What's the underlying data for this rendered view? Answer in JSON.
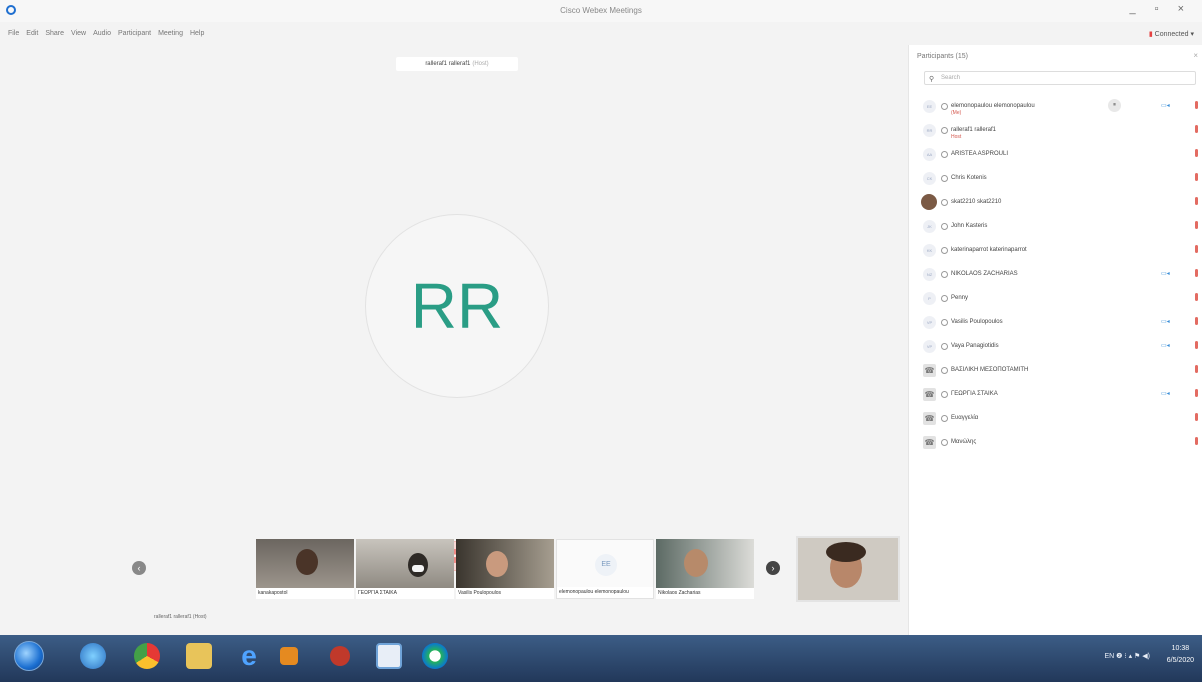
{
  "window": {
    "title": "Cisco Webex Meetings",
    "controls": "_ ▫ ×",
    "connection_status": "Connected ▾",
    "status_color": "#e54141"
  },
  "menu": [
    "File",
    "Edit",
    "Share",
    "View",
    "Audio",
    "Participant",
    "Meeting",
    "Help"
  ],
  "stage": {
    "active_speaker": "ralleraf1 ralleraf1",
    "active_speaker_role": "(Host)",
    "avatar_initials": "RR",
    "avatar_color": "#2a9d85",
    "mute_icon": "microphone-muted-icon"
  },
  "filmstrip": {
    "tiles": [
      {
        "label": "kanakapostol",
        "kind": "video"
      },
      {
        "label": "ΓΕΩΡΓΙΑ ΣΤΑΙΚΑ",
        "kind": "video"
      },
      {
        "label": "Vasilis Poulopoulos",
        "kind": "video"
      },
      {
        "label": "elemonopaulou elemonopaulou",
        "kind": "empty",
        "initials": "EE"
      },
      {
        "label": "Nikolaos Zacharias",
        "kind": "video"
      }
    ],
    "under_label": "ralleraf1 ralleraf1 (Host)"
  },
  "panel": {
    "title": "Participants (15)",
    "search_placeholder": "Search",
    "participants": [
      {
        "name": "elemonopaulou elemonopaulou",
        "sub": "(Me)",
        "initials": "EE",
        "cam": true,
        "badge": "⏸"
      },
      {
        "name": "ralleraf1 ralleraf1",
        "sub": "Host",
        "initials": "RR",
        "cam": false
      },
      {
        "name": "ARISTEA ASPROULI",
        "initials": "AA",
        "cam": false
      },
      {
        "name": "Chris Kotenis",
        "initials": "CK",
        "cam": false
      },
      {
        "name": "skat2210 skat2210",
        "initials": "",
        "photo": true,
        "cam": false
      },
      {
        "name": "John Kasteris",
        "initials": "JK",
        "cam": false
      },
      {
        "name": "katerinaparrot katerinaparrot",
        "initials": "KK",
        "cam": false
      },
      {
        "name": "NIKOLAOS ZACHARIAS",
        "initials": "NZ",
        "cam": true
      },
      {
        "name": "Penny",
        "initials": "P",
        "cam": false
      },
      {
        "name": "Vasilis Poulopoulos",
        "initials": "VP",
        "cam": true
      },
      {
        "name": "Vaya Panagiotidis",
        "initials": "VP",
        "cam": true
      },
      {
        "name": "ΒΑΣΙΛΙΚΗ ΜΕΣΟΠΟΤΑΜΙΤΗ",
        "initials": "☎",
        "phone": true,
        "cam": false
      },
      {
        "name": "ΓΕΩΡΓΙΑ ΣΤΑΙΚΑ",
        "initials": "☎",
        "phone": true,
        "cam": true
      },
      {
        "name": "Ευαγγελία",
        "initials": "☎",
        "phone": true,
        "cam": false
      },
      {
        "name": "Μανώλης",
        "initials": "☎",
        "phone": true,
        "cam": false
      }
    ]
  },
  "taskbar": {
    "language": "EN",
    "time": "10:38",
    "date": "6/5/2020"
  }
}
